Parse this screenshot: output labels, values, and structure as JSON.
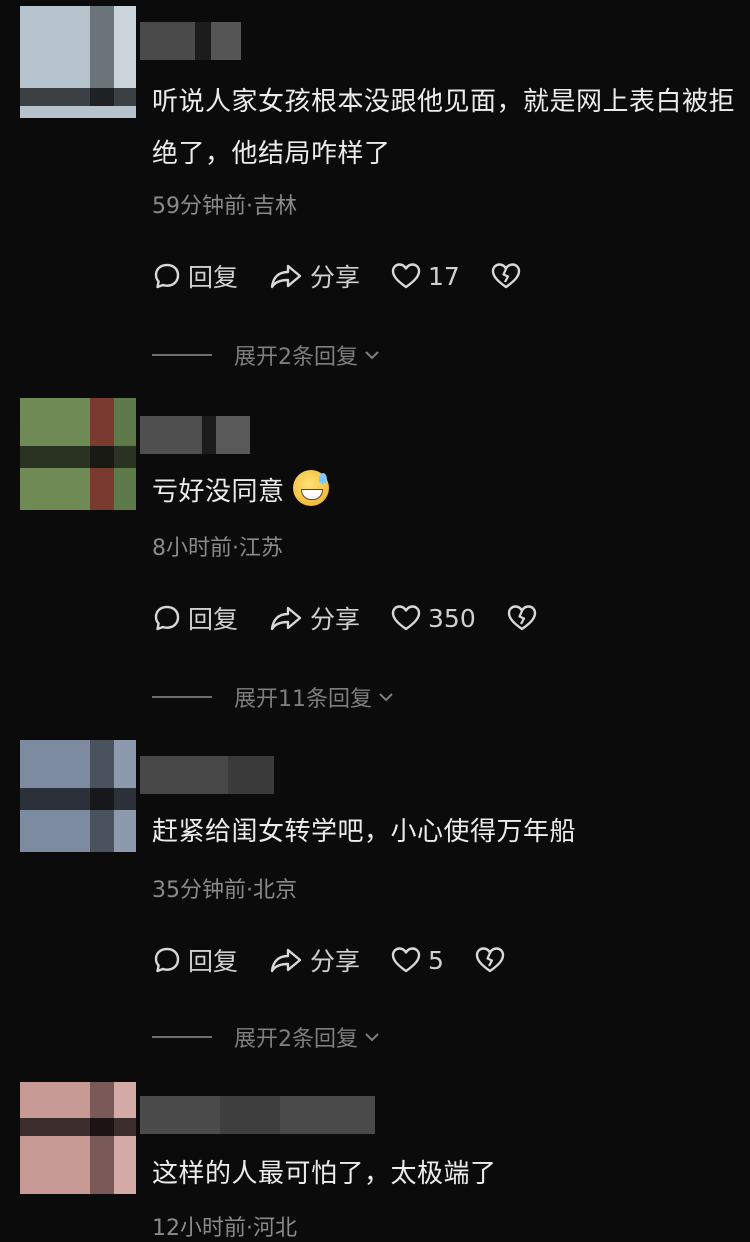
{
  "comments": [
    {
      "text": "听说人家女孩根本没跟他见面，就是网上表白被拒绝了，他结局咋样了",
      "time_location": "59分钟前·吉林",
      "reply_label": "回复",
      "share_label": "分享",
      "likes": "17",
      "expand_label": "展开2条回复",
      "avatar_colors": [
        "#b7c3cc",
        "#6a7479",
        "#cbd4da",
        "#3a4044"
      ]
    },
    {
      "text": "亏好没同意",
      "emoji": "grinning-sweat-emoji",
      "time_location": "8小时前·江苏",
      "reply_label": "回复",
      "share_label": "分享",
      "likes": "350",
      "expand_label": "展开11条回复",
      "avatar_colors": [
        "#6f8a55",
        "#7a3a30",
        "#5d7a48",
        "#2a3222"
      ]
    },
    {
      "text": "赶紧给闺女转学吧，小心使得万年船",
      "time_location": "35分钟前·北京",
      "reply_label": "回复",
      "share_label": "分享",
      "likes": "5",
      "expand_label": "展开2条回复",
      "avatar_colors": [
        "#7c8ba0",
        "#4a525e",
        "#8d9aae",
        "#2c3038"
      ]
    },
    {
      "text": "这样的人最可怕了，太极端了",
      "time_location": "12小时前·河北",
      "avatar_colors": [
        "#c89a96",
        "#7a5a58",
        "#d4aaa6",
        "#3c2e2d"
      ]
    }
  ],
  "icons": {
    "reply": "comment-bubble-icon",
    "share": "share-arrow-icon",
    "like": "heart-icon",
    "dislike": "broken-heart-icon",
    "expand": "chevron-down-icon"
  },
  "colors": {
    "background": "#0b0b0b",
    "text": "#ececec",
    "meta": "#8a8a8a"
  }
}
